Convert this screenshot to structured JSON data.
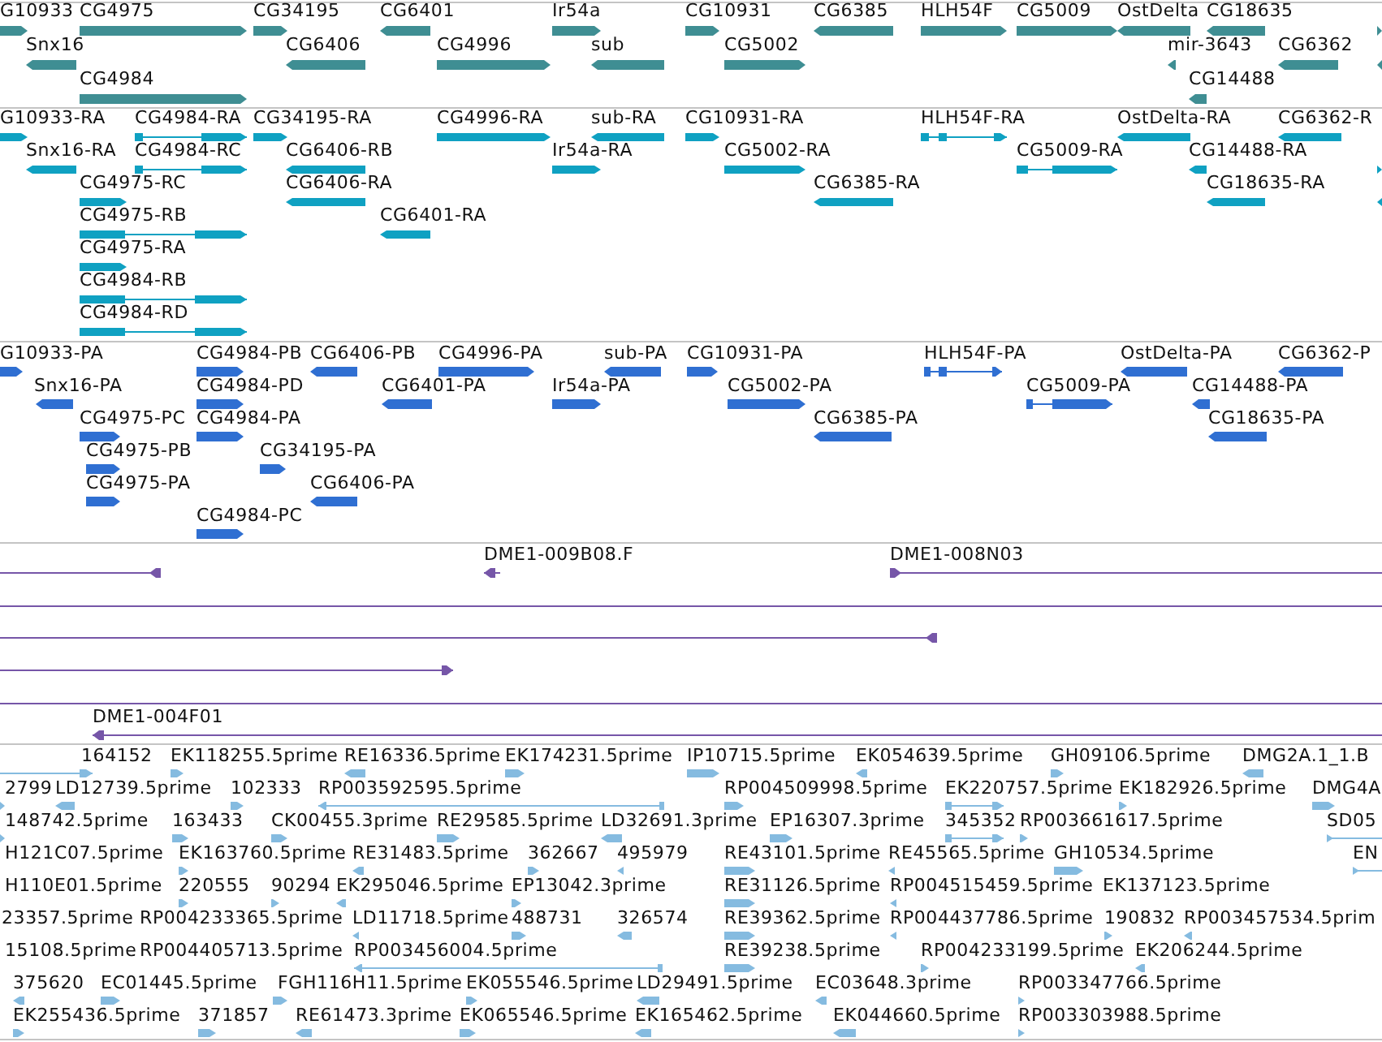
{
  "tracks": [
    {
      "kind": "gene",
      "rows": [
        {
          "features": [
            {
              "label": "G10933",
              "reverse": false
            },
            {
              "label": "CG4975",
              "reverse": false
            },
            {
              "label": "CG34195",
              "reverse": false
            },
            {
              "label": "CG6401",
              "reverse": true
            },
            {
              "label": "Ir54a",
              "reverse": false
            },
            {
              "label": "CG10931",
              "reverse": false
            },
            {
              "label": "CG6385",
              "reverse": true
            },
            {
              "label": "HLH54F",
              "reverse": false
            },
            {
              "label": "CG5009",
              "reverse": false
            },
            {
              "label": "OstDelta",
              "reverse": true
            },
            {
              "label": "CG18635",
              "reverse": true
            },
            {
              "reverse": false
            }
          ]
        },
        {
          "features": [
            {
              "label": "Snx16",
              "reverse": true
            },
            {
              "label": "CG6406",
              "reverse": true
            },
            {
              "label": "CG4996",
              "reverse": false
            },
            {
              "label": "sub",
              "reverse": true
            },
            {
              "label": "CG5002",
              "reverse": false
            },
            {
              "label": "mir-3643",
              "reverse": true
            },
            {
              "label": "CG6362",
              "reverse": true
            },
            {
              "reverse": true
            }
          ]
        },
        {
          "features": [
            {
              "label": "CG4984",
              "reverse": false
            },
            {
              "label": "CG14488",
              "reverse": true
            }
          ]
        }
      ]
    },
    {
      "kind": "transcript",
      "rows": [
        {
          "features": [
            {
              "label": "G10933-RA",
              "reverse": false
            },
            {
              "label": "CG4984-RA",
              "reverse": false
            },
            {
              "label": "CG34195-RA",
              "reverse": false
            },
            {
              "label": "CG4996-RA",
              "reverse": false
            },
            {
              "label": "sub-RA",
              "reverse": true
            },
            {
              "label": "CG10931-RA",
              "reverse": false
            },
            {
              "label": "HLH54F-RA",
              "reverse": false
            },
            {
              "label": "OstDelta-RA",
              "reverse": true
            },
            {
              "label": "CG6362-R",
              "reverse": true
            }
          ]
        },
        {
          "features": [
            {
              "label": "Snx16-RA",
              "reverse": true
            },
            {
              "label": "CG4984-RC",
              "reverse": false
            },
            {
              "label": "CG6406-RB",
              "reverse": true
            },
            {
              "label": "Ir54a-RA",
              "reverse": false
            },
            {
              "label": "CG5002-RA",
              "reverse": false
            },
            {
              "label": "CG5009-RA",
              "reverse": false
            },
            {
              "label": "CG14488-RA",
              "reverse": true
            },
            {
              "reverse": false
            }
          ]
        },
        {
          "features": [
            {
              "label": "CG4975-RC",
              "reverse": false
            },
            {
              "label": "CG6406-RA",
              "reverse": true
            },
            {
              "label": "CG6385-RA",
              "reverse": true
            },
            {
              "label": "CG18635-RA",
              "reverse": true
            },
            {
              "reverse": true
            }
          ]
        },
        {
          "features": [
            {
              "label": "CG4975-RB",
              "reverse": false
            },
            {
              "label": "CG6401-RA",
              "reverse": true
            }
          ]
        },
        {
          "features": [
            {
              "label": "CG4975-RA",
              "reverse": false
            }
          ]
        },
        {
          "features": [
            {
              "label": "CG4984-RB",
              "reverse": false
            }
          ]
        },
        {
          "features": [
            {
              "label": "CG4984-RD",
              "reverse": false
            }
          ]
        }
      ]
    },
    {
      "kind": "protein",
      "rows": [
        {
          "features": [
            {
              "label": "G10933-PA",
              "reverse": false
            },
            {
              "label": "CG4984-PB",
              "reverse": false
            },
            {
              "label": "CG6406-PB",
              "reverse": true
            },
            {
              "label": "CG4996-PA",
              "reverse": false
            },
            {
              "label": "sub-PA",
              "reverse": true
            },
            {
              "label": "CG10931-PA",
              "reverse": false
            },
            {
              "label": "HLH54F-PA",
              "reverse": false
            },
            {
              "label": "OstDelta-PA",
              "reverse": true
            },
            {
              "label": "CG6362-P",
              "reverse": true
            }
          ]
        },
        {
          "features": [
            {
              "label": "Snx16-PA",
              "reverse": true
            },
            {
              "label": "CG4984-PD",
              "reverse": false
            },
            {
              "label": "CG6401-PA",
              "reverse": true
            },
            {
              "label": "Ir54a-PA",
              "reverse": false
            },
            {
              "label": "CG5002-PA",
              "reverse": false
            },
            {
              "label": "CG5009-PA",
              "reverse": false
            },
            {
              "label": "CG14488-PA",
              "reverse": true
            }
          ]
        },
        {
          "features": [
            {
              "label": "CG4975-PC",
              "reverse": false
            },
            {
              "label": "CG4984-PA",
              "reverse": false
            },
            {
              "label": "CG6385-PA",
              "reverse": true
            },
            {
              "label": "CG18635-PA",
              "reverse": true
            }
          ]
        },
        {
          "features": [
            {
              "label": "CG4975-PB",
              "reverse": false
            },
            {
              "label": "CG34195-PA",
              "reverse": false
            }
          ]
        },
        {
          "features": [
            {
              "label": "CG4975-PA",
              "reverse": false
            },
            {
              "label": "CG6406-PA",
              "reverse": true
            }
          ]
        },
        {
          "features": [
            {
              "label": "CG4984-PC",
              "reverse": false
            }
          ]
        }
      ]
    },
    {
      "kind": "clone",
      "rows": [
        {
          "features": [
            {
              "marker": true,
              "reverse": true
            },
            {
              "label": "DME1-009B08.F",
              "marker": true,
              "reverse": true
            },
            {
              "label": "DME1-008N03",
              "marker": true,
              "reverse": false
            }
          ]
        },
        {
          "features": [
            {
              "marker": false
            }
          ]
        },
        {
          "features": [
            {
              "marker": true,
              "reverse": true
            }
          ]
        },
        {
          "features": [
            {
              "marker": true,
              "reverse": false
            }
          ]
        },
        {
          "features": [
            {
              "marker": false
            }
          ]
        },
        {
          "features": [
            {
              "label": "DME1-004F01",
              "marker": true,
              "reverse": true
            }
          ]
        }
      ]
    },
    {
      "kind": "est",
      "rows": [
        {
          "features": [
            {
              "label": "164152",
              "reverse": false
            },
            {
              "label": "EK118255.5prime",
              "reverse": false
            },
            {
              "label": "RE16336.5prime",
              "reverse": true
            },
            {
              "label": "EK174231.5prime",
              "reverse": false
            },
            {
              "label": "IP10715.5prime",
              "reverse": false
            },
            {
              "label": "EK054639.5prime",
              "reverse": true
            },
            {
              "label": "GH09106.5prime",
              "reverse": false
            },
            {
              "label": "DMG2A.1_1.B",
              "reverse": true
            }
          ]
        },
        {
          "features": [
            {
              "label": "2799",
              "reverse": false
            },
            {
              "label": "LD12739.5prime",
              "reverse": true
            },
            {
              "label": "102333",
              "reverse": false
            },
            {
              "label": "RP003592595.5prime",
              "reverse": true
            },
            {
              "label": "RP004509998.5prime",
              "reverse": false
            },
            {
              "label": "EK220757.5prime",
              "reverse": false
            },
            {
              "label": "EK182926.5prime",
              "reverse": false
            },
            {
              "label": "DMG4A",
              "reverse": false
            }
          ]
        },
        {
          "features": [
            {
              "label": "148742.5prime",
              "reverse": false
            },
            {
              "label": "163433",
              "reverse": false
            },
            {
              "label": "CK00455.3prime",
              "reverse": false
            },
            {
              "label": "RE29585.5prime",
              "reverse": false
            },
            {
              "label": "LD32691.3prime",
              "reverse": true
            },
            {
              "label": "EP16307.3prime",
              "reverse": false
            },
            {
              "label": "345352",
              "reverse": false
            },
            {
              "label": "RP003661617.5prime",
              "reverse": false
            },
            {
              "label": "SD05",
              "reverse": false
            }
          ]
        },
        {
          "features": [
            {
              "label": "H121C07.5prime"
            },
            {
              "label": "EK163760.5prime",
              "reverse": false
            },
            {
              "label": "RE31483.5prime",
              "reverse": true
            },
            {
              "label": "362667",
              "reverse": false
            },
            {
              "label": "495979",
              "reverse": true
            },
            {
              "label": "RE43101.5prime",
              "reverse": false
            },
            {
              "label": "RE45565.5prime",
              "reverse": true
            },
            {
              "label": "GH10534.5prime",
              "reverse": false
            },
            {
              "label": "EN",
              "reverse": false
            }
          ]
        },
        {
          "features": [
            {
              "label": "H110E01.5prime"
            },
            {
              "label": "220555",
              "reverse": false
            },
            {
              "label": "90294",
              "reverse": false
            },
            {
              "label": "EK295046.5prime",
              "reverse": true
            },
            {
              "label": "EP13042.3prime",
              "reverse": false
            },
            {
              "label": "RE31126.5prime",
              "reverse": false
            },
            {
              "label": "RP004515459.5prime",
              "reverse": true
            },
            {
              "label": "EK137123.5prime"
            }
          ]
        },
        {
          "features": [
            {
              "label": "23357.5prime"
            },
            {
              "label": "RP004233365.5prime"
            },
            {
              "label": "LD11718.5prime",
              "reverse": true
            },
            {
              "label": "488731",
              "reverse": false
            },
            {
              "label": "326574",
              "reverse": true
            },
            {
              "label": "RE39362.5prime",
              "reverse": false
            },
            {
              "label": "RP004437786.5prime",
              "reverse": true
            },
            {
              "label": "190832",
              "reverse": false
            },
            {
              "label": "RP003457534.5prim",
              "reverse": true
            }
          ]
        },
        {
          "features": [
            {
              "label": "15108.5prime"
            },
            {
              "label": "RP004405713.5prime"
            },
            {
              "label": "RP003456004.5prime",
              "reverse": true
            },
            {
              "label": "RE39238.5prime",
              "reverse": false
            },
            {
              "label": "RP004233199.5prime",
              "reverse": false
            },
            {
              "label": "EK206244.5prime",
              "reverse": true
            }
          ]
        },
        {
          "features": [
            {
              "label": "375620",
              "reverse": true
            },
            {
              "label": "EC01445.5prime",
              "reverse": false
            },
            {
              "label": "FGH116H11.5prime",
              "reverse": false
            },
            {
              "label": "EK055546.5prime",
              "reverse": false
            },
            {
              "label": "LD29491.5prime",
              "reverse": true
            },
            {
              "label": "EC03648.3prime",
              "reverse": true
            },
            {
              "label": "RP003347766.5prime",
              "reverse": false
            }
          ]
        },
        {
          "features": [
            {
              "label": "EK255436.5prime",
              "reverse": false
            },
            {
              "label": "371857",
              "reverse": false
            },
            {
              "label": "RE61473.3prime",
              "reverse": true
            },
            {
              "label": "EK065546.5prime",
              "reverse": false
            },
            {
              "label": "EK165462.5prime",
              "reverse": true
            },
            {
              "label": "EK044660.5prime",
              "reverse": true
            },
            {
              "label": "RP003303988.5prime",
              "reverse": false
            }
          ]
        }
      ]
    }
  ]
}
